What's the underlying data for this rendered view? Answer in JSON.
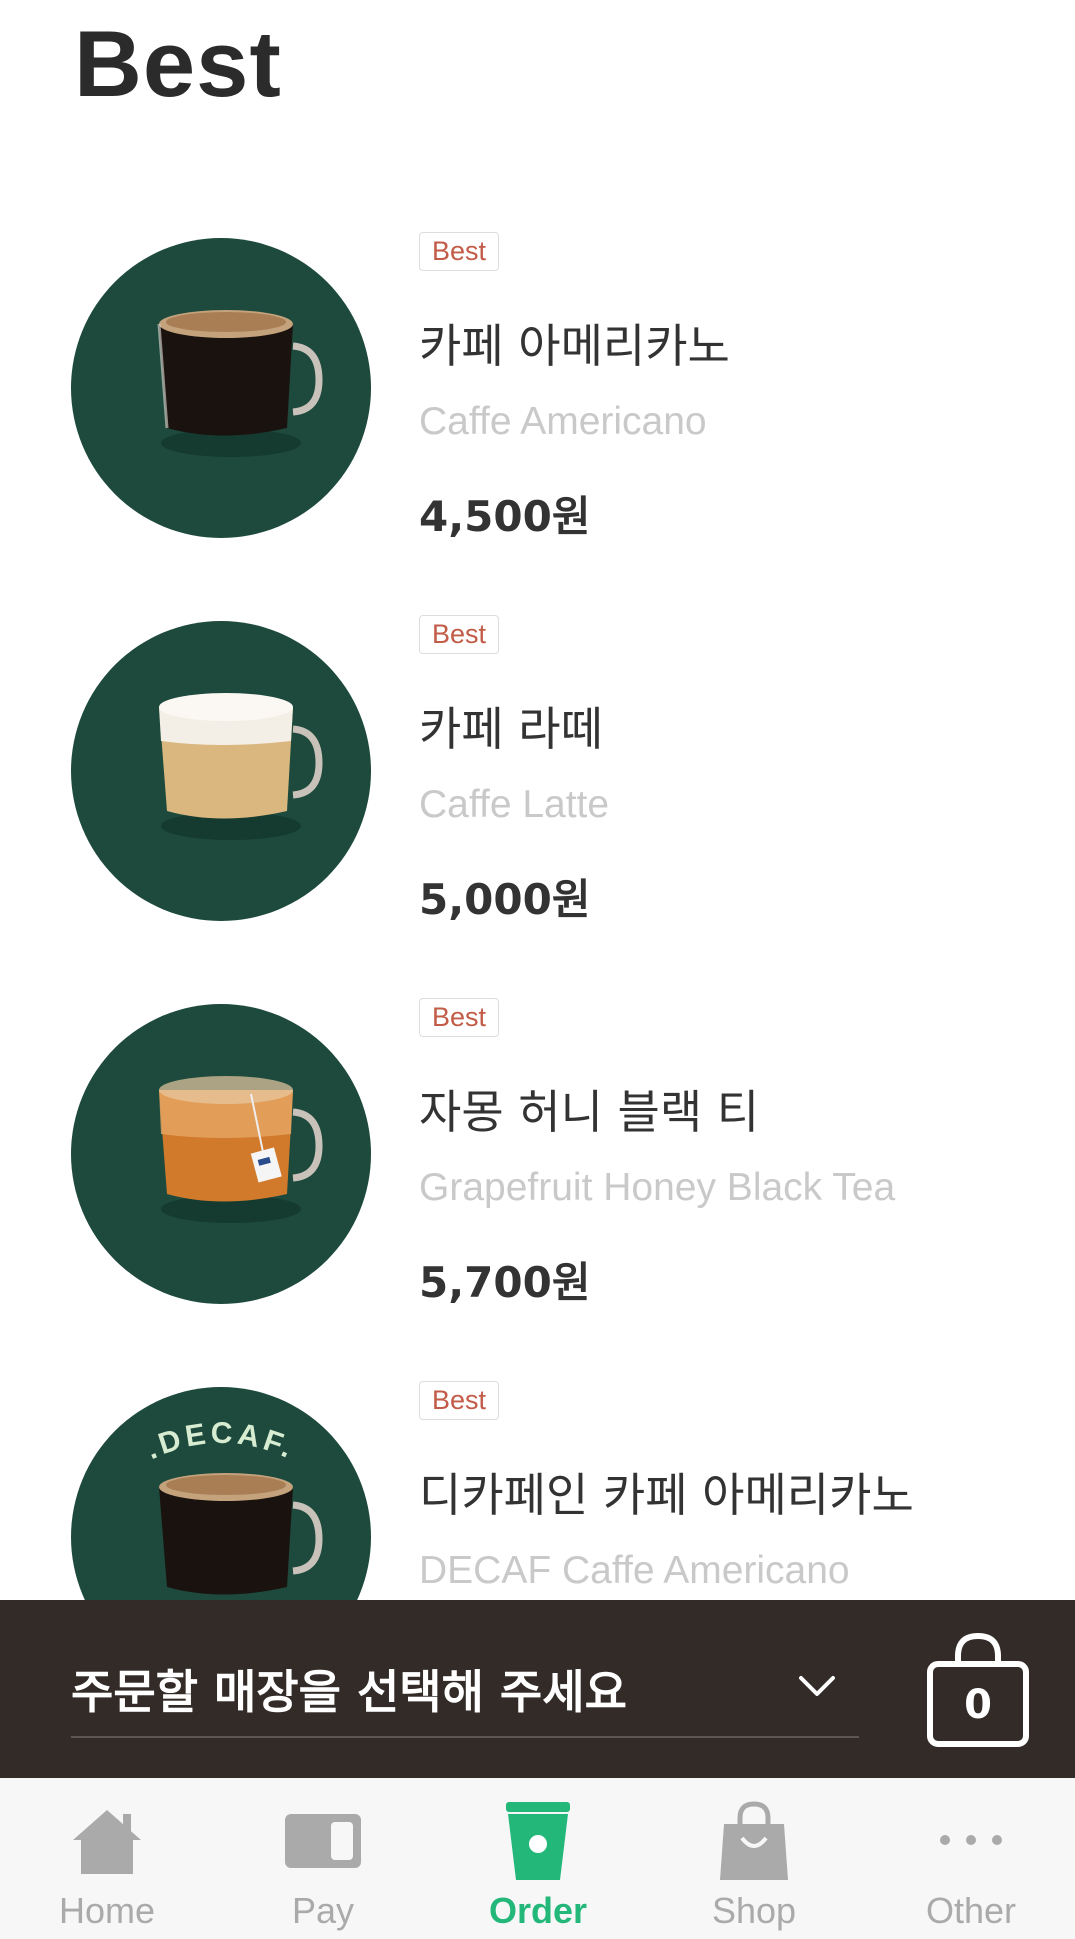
{
  "page": {
    "title": "Best"
  },
  "menu_items": [
    {
      "badge": "Best",
      "name_ko": "카페 아메리카노",
      "name_en": "Caffe Americano",
      "price": "4,500원"
    },
    {
      "badge": "Best",
      "name_ko": "카페 라떼",
      "name_en": "Caffe Latte",
      "price": "5,000원"
    },
    {
      "badge": "Best",
      "name_ko": "자몽 허니 블랙 티",
      "name_en": "Grapefruit Honey Black Tea",
      "price": "5,700원"
    },
    {
      "badge": "Best",
      "name_ko": "디카페인 카페 아메리카노",
      "name_en": "DECAF Caffe Americano",
      "price": "",
      "image_text": ".DECAF."
    }
  ],
  "store_bar": {
    "select_label": "주문할 매장을 선택해 주세요",
    "cart_count": "0"
  },
  "tabbar": {
    "tabs": [
      {
        "label": "Home",
        "icon": "home-icon"
      },
      {
        "label": "Pay",
        "icon": "card-icon"
      },
      {
        "label": "Order",
        "icon": "cup-icon",
        "active": true
      },
      {
        "label": "Shop",
        "icon": "shopping-bag-icon"
      },
      {
        "label": "Other",
        "icon": "more-icon"
      }
    ]
  },
  "colors": {
    "thumb_bg": "#1d4a3d",
    "badge_text": "#c25b47",
    "store_bar_bg": "#322b27",
    "active_tab": "#23b87a"
  }
}
